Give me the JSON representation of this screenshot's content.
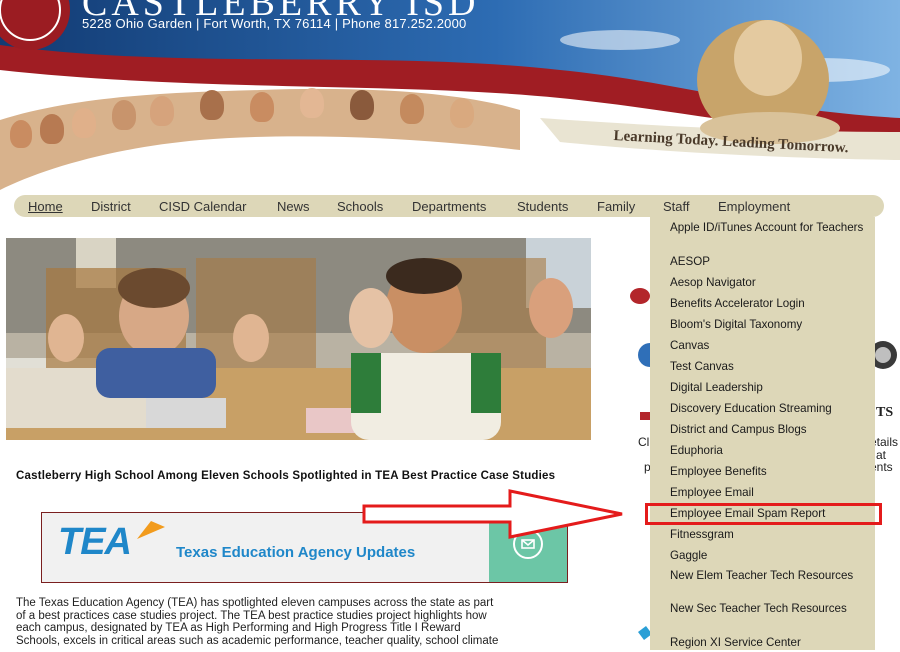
{
  "header": {
    "school_name": "CASTLEBERRY ISD",
    "address": "5228 Ohio Garden | Fort Worth, TX 76114 | Phone 817.252.2000",
    "tagline": "Learning Today. Leading Tomorrow."
  },
  "nav": {
    "items": [
      "Home",
      "District",
      "CISD Calendar",
      "News",
      "Schools",
      "Departments",
      "Students",
      "Family",
      "Staff",
      "Employment"
    ],
    "active": "Home",
    "open_menu": "Staff"
  },
  "staff_menu": {
    "items": [
      "Apple ID/iTunes Account for Teachers",
      "AESOP",
      "Aesop Navigator",
      "Benefits Accelerator Login",
      "Bloom's Digital Taxonomy",
      "Canvas",
      "Test Canvas",
      "Digital Leadership",
      "Discovery Education Streaming",
      "District and Campus Blogs",
      "Eduphoria",
      "Employee Benefits",
      "Employee Email",
      "Employee Email Spam Report",
      "Fitnessgram",
      "Gaggle",
      "New Elem Teacher Tech Resources",
      "New Sec Teacher Tech Resources",
      "Region XI Service Center"
    ],
    "highlighted": "Employee Email Spam Report"
  },
  "article": {
    "headline": "Castleberry High School Among Eleven Schools Spotlighted in TEA Best Practice Case Studies",
    "tea_logo": "TEA",
    "tea_banner_text": "Texas Education Agency Updates",
    "body_line1": "The Texas Education Agency (TEA) has spotlighted eleven campuses across the state as part",
    "body_line2": "of a best practices case studies project. The TEA best practice studies project highlights how",
    "body_line3": "each campus, designated by TEA as High Performing and High Progress Title I Reward",
    "body_line4": "Schools, excels in critical areas such as academic performance, teacher quality, school climate"
  },
  "right_peek": {
    "ts": "TS",
    "cl": "Cl",
    "etails": "etails",
    "at": "at",
    "p": "p",
    "ents": "ents"
  },
  "colors": {
    "banner_blue": "#1f4f8a",
    "banner_red": "#9b1c22",
    "nav_bg": "#ddd7b8",
    "annotation_red": "#e41b1b",
    "tea_blue": "#1f87c9",
    "tea_green": "#6cc6a6"
  }
}
